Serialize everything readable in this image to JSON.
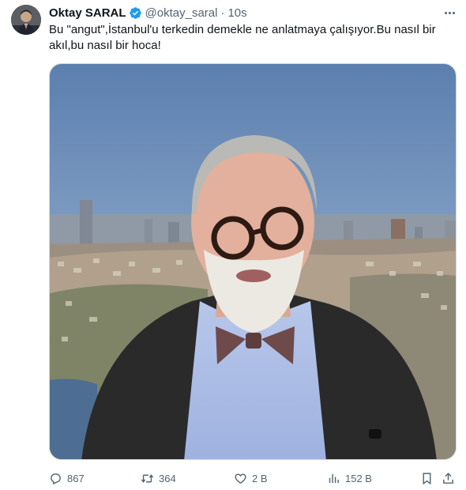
{
  "author": {
    "display_name": "Oktay SARAL",
    "handle": "@oktay_saral",
    "separator": "·",
    "time": "10s",
    "verified": true,
    "verified_color": "#1d9bf0"
  },
  "tweet": {
    "text": "Bu \"angut\",İstanbul'u terkedin demekle ne anlatmaya çalışıyor.Bu nasıl bir akıl,bu nasıl bir hoca!"
  },
  "actions": {
    "reply_count": "867",
    "retweet_count": "364",
    "like_count": "2 B",
    "views_count": "152 B"
  },
  "icons": {
    "more": "more-horizontal-icon",
    "reply": "reply-icon",
    "retweet": "retweet-icon",
    "like": "heart-icon",
    "views": "analytics-icon",
    "bookmark": "bookmark-icon",
    "share": "share-icon"
  },
  "colors": {
    "text": "#0f1419",
    "secondary": "#536471",
    "border": "#cfd9de"
  }
}
